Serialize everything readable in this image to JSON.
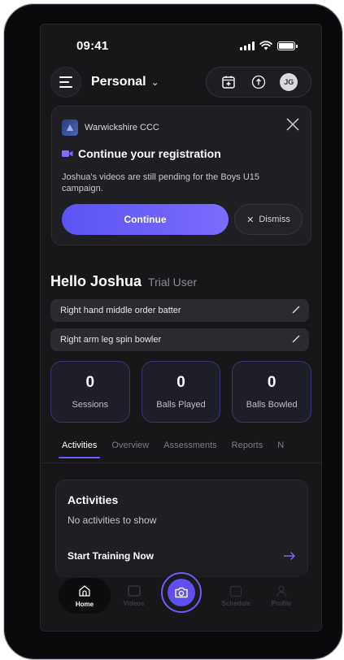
{
  "status_bar": {
    "time": "09:41"
  },
  "header": {
    "workspace": "Personal",
    "avatar_initials": "JG"
  },
  "registration_card": {
    "club_name": "Warwickshire CCC",
    "title": "Continue your registration",
    "description": "Joshua's videos are still pending for the Boys U15 campaign.",
    "continue_label": "Continue",
    "dismiss_label": "Dismiss"
  },
  "profile": {
    "greeting": "Hello Joshua",
    "role": "Trial User",
    "skills": [
      "Right hand middle order batter",
      "Right arm leg spin bowler"
    ]
  },
  "stats": [
    {
      "value": "0",
      "label": "Sessions"
    },
    {
      "value": "0",
      "label": "Balls Played"
    },
    {
      "value": "0",
      "label": "Balls Bowled"
    }
  ],
  "tabs": [
    "Activities",
    "Overview",
    "Assessments",
    "Reports",
    "N"
  ],
  "active_tab": "Activities",
  "activities": {
    "title": "Activities",
    "empty_text": "No activities to show",
    "cta": "Start Training Now"
  },
  "bottom_nav": {
    "items": [
      "Home",
      "Videos",
      "Schedule",
      "Profile"
    ],
    "active": "Home"
  },
  "colors": {
    "accent": "#6c63ff",
    "background": "#17171a",
    "card": "#1f1f23"
  }
}
